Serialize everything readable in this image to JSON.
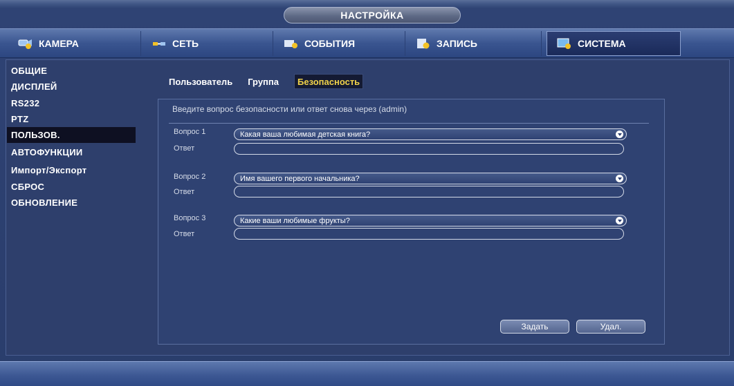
{
  "window": {
    "title": "НАСТРОЙКА"
  },
  "tabs": [
    {
      "label": "КАМЕРА",
      "icon": "camera-icon",
      "active": false
    },
    {
      "label": "СЕТЬ",
      "icon": "network-icon",
      "active": false
    },
    {
      "label": "СОБЫТИЯ",
      "icon": "events-icon",
      "active": false
    },
    {
      "label": "ЗАПИСЬ",
      "icon": "record-icon",
      "active": false
    },
    {
      "label": "СИСТЕМА",
      "icon": "system-icon",
      "active": true
    }
  ],
  "sidebar": {
    "items": [
      {
        "label": "ОБЩИЕ"
      },
      {
        "label": "ДИСПЛЕЙ"
      },
      {
        "label": "RS232"
      },
      {
        "label": "PTZ"
      },
      {
        "label": "ПОЛЬЗОВ.",
        "selected": true
      },
      {
        "label": "АВТОФУНКЦИИ"
      },
      {
        "label": "Импорт/Экспорт"
      },
      {
        "label": "СБРОС"
      },
      {
        "label": "ОБНОВЛЕНИЕ"
      }
    ]
  },
  "subtabs": [
    {
      "label": "Пользователь"
    },
    {
      "label": "Группа"
    },
    {
      "label": "Безопасность",
      "active": true
    }
  ],
  "security": {
    "intro": "Введите вопрос безопасности или ответ снова через (admin)",
    "questions": [
      {
        "label": "Вопрос 1",
        "value": "Какая ваша любимая детская книга?",
        "answer_label": "Ответ",
        "answer": ""
      },
      {
        "label": "Вопрос 2",
        "value": "Имя вашего первого начальника?",
        "answer_label": "Ответ",
        "answer": ""
      },
      {
        "label": "Вопрос 3",
        "value": "Какие ваши любимые фрукты?",
        "answer_label": "Ответ",
        "answer": ""
      }
    ]
  },
  "buttons": {
    "set": "Задать",
    "delete": "Удал."
  },
  "colors": {
    "active_subtab": "#f0d24a",
    "selected_sidebar": "#0e1022",
    "panel": "#2e3f6c"
  }
}
